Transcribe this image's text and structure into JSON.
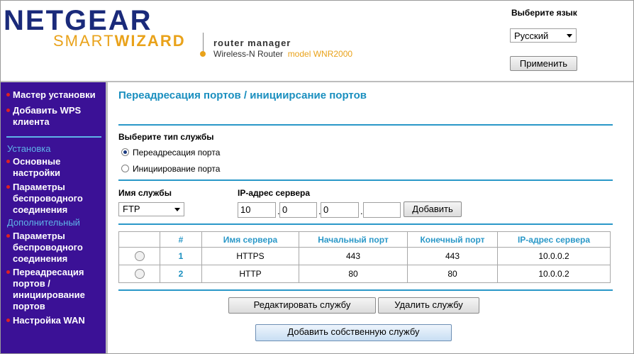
{
  "header": {
    "brand": "NETGEAR",
    "smart": "SMART",
    "wizard": "WIZARD",
    "router_manager": "router manager",
    "router_type": "Wireless-N Router",
    "model": "model WNR2000"
  },
  "language": {
    "label": "Выберите язык",
    "selected": "Русский",
    "apply_label": "Применить"
  },
  "sidebar": {
    "top_items": [
      {
        "label": "Мастер установки"
      },
      {
        "label": "Добавить WPS\nклиента"
      }
    ],
    "section_setup": "Установка",
    "setup_items": [
      {
        "label": "Основные\nнастройки"
      },
      {
        "label": "Параметры\nбеспроводного\nсоединения"
      }
    ],
    "section_advanced": "Дополнительный",
    "advanced_items": [
      {
        "label": "Параметры\nбеспроводного\nсоединения"
      },
      {
        "label": "Переадресация\nпортов /\nинициирование\nпортов"
      },
      {
        "label": "Настройка WAN"
      }
    ]
  },
  "main": {
    "title": "Переадресация портов / инициирсание портов",
    "service_type_label": "Выберите тип службы",
    "option_forwarding": "Переадресация порта",
    "option_triggering": "Инициирование порта",
    "service_name_label": "Имя службы",
    "service_name_value": "FTP",
    "server_ip_label": "IP-адрес сервера",
    "ip_octets": [
      "10",
      "0",
      "0",
      ""
    ],
    "add_label": "Добавить",
    "table": {
      "headers": [
        "#",
        "Имя сервера",
        "Начальный порт",
        "Конечный порт",
        "IP-адрес сервера"
      ],
      "rows": [
        {
          "num": "1",
          "name": "HTTPS",
          "start": "443",
          "end": "443",
          "ip": "10.0.0.2"
        },
        {
          "num": "2",
          "name": "HTTP",
          "start": "80",
          "end": "80",
          "ip": "10.0.0.2"
        }
      ]
    },
    "edit_label": "Редактировать службу",
    "delete_label": "Удалить службу",
    "add_custom_label": "Добавить собственную службу"
  },
  "colors": {
    "sidebar_bg": "#3b1196",
    "accent_blue": "#2a98c8",
    "brand_navy": "#1a2a7a",
    "brand_orange": "#e9a21a",
    "bullet_red": "#e02020"
  }
}
